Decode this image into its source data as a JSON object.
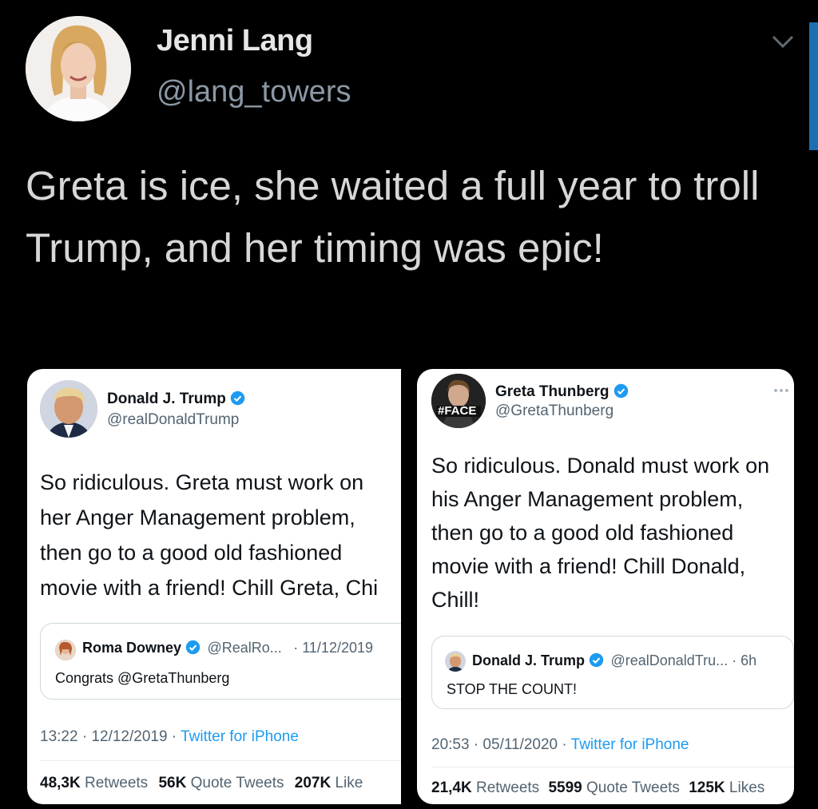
{
  "author": {
    "name": "Jenni Lang",
    "handle": "@lang_towers"
  },
  "tweet": {
    "text": "Greta is ice, she waited a full year to troll Trump, and her timing was epic!"
  },
  "left_card": {
    "name": "Donald J. Trump",
    "handle": "@realDonaldTrump",
    "body_lines": [
      "So ridiculous. Greta must work on",
      "her Anger Management problem,",
      "then go to a good old fashioned",
      "movie with a friend! Chill Greta, Chi"
    ],
    "quote": {
      "name": "Roma Downey",
      "handle": "@RealRo...",
      "date": "· 11/12/2019",
      "text": "Congrats @GretaThunberg"
    },
    "time": "13:22 · 12/12/2019 · ",
    "source": "Twitter for iPhone",
    "stats": {
      "retweets": "48,3K",
      "retweets_label": "Retweets",
      "quotes": "56K",
      "quotes_label": "Quote Tweets",
      "likes": "207K",
      "likes_label": "Like"
    }
  },
  "right_card": {
    "name": "Greta Thunberg",
    "handle": "@GretaThunberg",
    "badge_text": "#FACE",
    "body_lines": [
      "So ridiculous. Donald must work on",
      "his Anger Management problem,",
      "then go to a good old fashioned",
      "movie with a friend! Chill Donald,",
      "Chill!"
    ],
    "quote": {
      "name": "Donald J. Trump",
      "handle": "@realDonaldTru... · 6h",
      "text": "STOP THE COUNT!"
    },
    "time": "20:53 · 05/11/2020 · ",
    "source": "Twitter for iPhone",
    "stats": {
      "retweets": "21,4K",
      "retweets_label": "Retweets",
      "quotes": "5599",
      "quotes_label": "Quote Tweets",
      "likes": "125K",
      "likes_label": "Likes"
    }
  },
  "colors": {
    "background": "#000000",
    "link": "#1d9bf0",
    "verified": "#1d9bf0"
  }
}
